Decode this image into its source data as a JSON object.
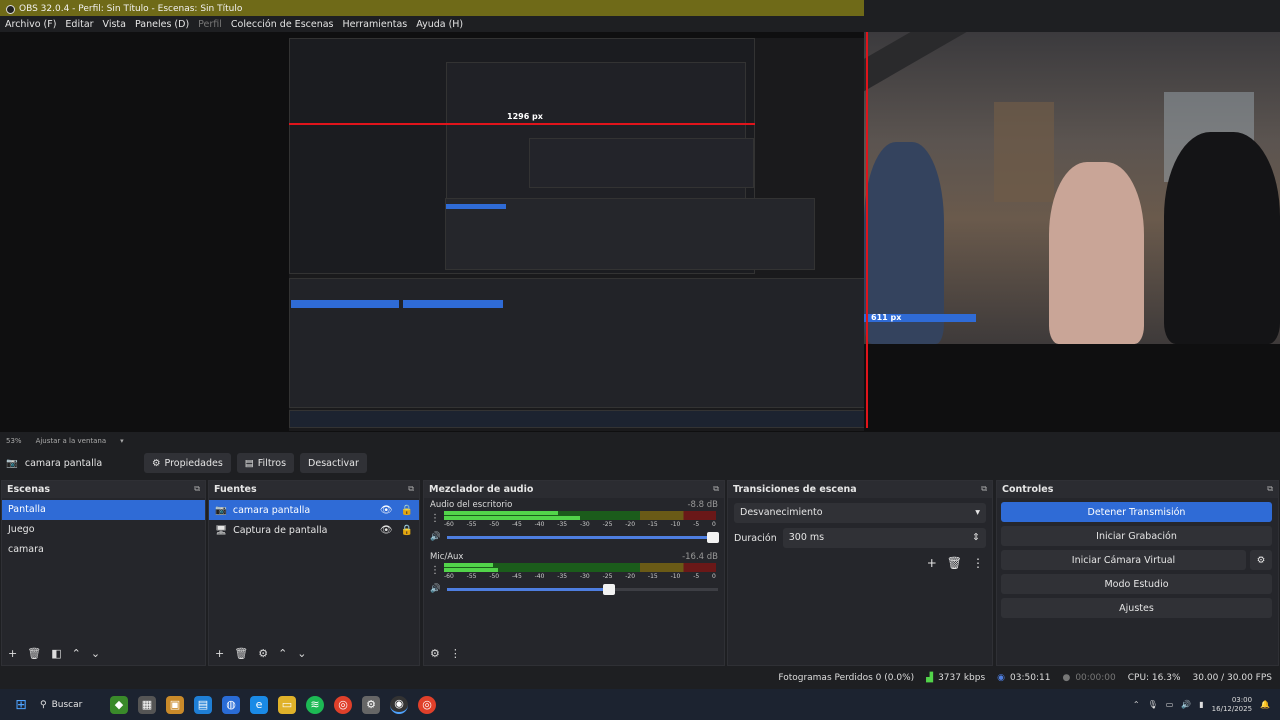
{
  "window": {
    "title": "OBS 32.0.4 - Perfil: Sin Título - Escenas: Sin Título"
  },
  "menu": {
    "items": [
      "Archivo (F)",
      "Editar",
      "Vista",
      "Paneles (D)",
      "Perfil",
      "Colección de Escenas",
      "Herramientas",
      "Ayuda (H)"
    ]
  },
  "preview": {
    "measure_label_1": "1296 px",
    "measure_label_2": "611 px",
    "zoom": "53%",
    "fit_label": "Ajustar a la ventana"
  },
  "source_toolbar": {
    "source_name": "camara pantalla",
    "properties": "Propiedades",
    "filters": "Filtros",
    "deactivate": "Desactivar"
  },
  "scenes": {
    "title": "Escenas",
    "items": [
      "Pantalla",
      "Juego",
      "camara"
    ]
  },
  "sources": {
    "title": "Fuentes",
    "items": [
      "camara pantalla",
      "Captura de pantalla"
    ]
  },
  "mixer": {
    "title": "Mezclador de audio",
    "channels": [
      {
        "name": "Audio del escritorio",
        "db": "-8.8 dB",
        "level": 0.98
      },
      {
        "name": "Mic/Aux",
        "db": "-16.4 dB",
        "level": 0.6
      }
    ],
    "ticks": [
      "-60",
      "-55",
      "-50",
      "-45",
      "-40",
      "-35",
      "-30",
      "-25",
      "-20",
      "-15",
      "-10",
      "-5",
      "0"
    ]
  },
  "transitions": {
    "title": "Transiciones de escena",
    "selected": "Desvanecimiento",
    "duration_label": "Duración",
    "duration_value": "300 ms"
  },
  "controls": {
    "title": "Controles",
    "stop_stream": "Detener Transmisión",
    "start_recording": "Iniciar Grabación",
    "start_virtualcam": "Iniciar Cámara Virtual",
    "studio_mode": "Modo Estudio",
    "settings": "Ajustes"
  },
  "stats": {
    "dropped_frames": "Fotogramas Perdidos 0 (0.0%)",
    "bitrate": "3737 kbps",
    "stream_time": "03:50:11",
    "record_time": "00:00:00",
    "cpu": "CPU: 16.3%",
    "fps": "30.00 / 30.00 FPS"
  },
  "taskbar": {
    "search_label": "Buscar",
    "time": "03:00",
    "date": "16/12/2025"
  },
  "colors": {
    "accent": "#2f6bd6",
    "titlebar": "#6f6a18",
    "meter_green": "#52d44a",
    "guide_red": "#e0141b"
  }
}
